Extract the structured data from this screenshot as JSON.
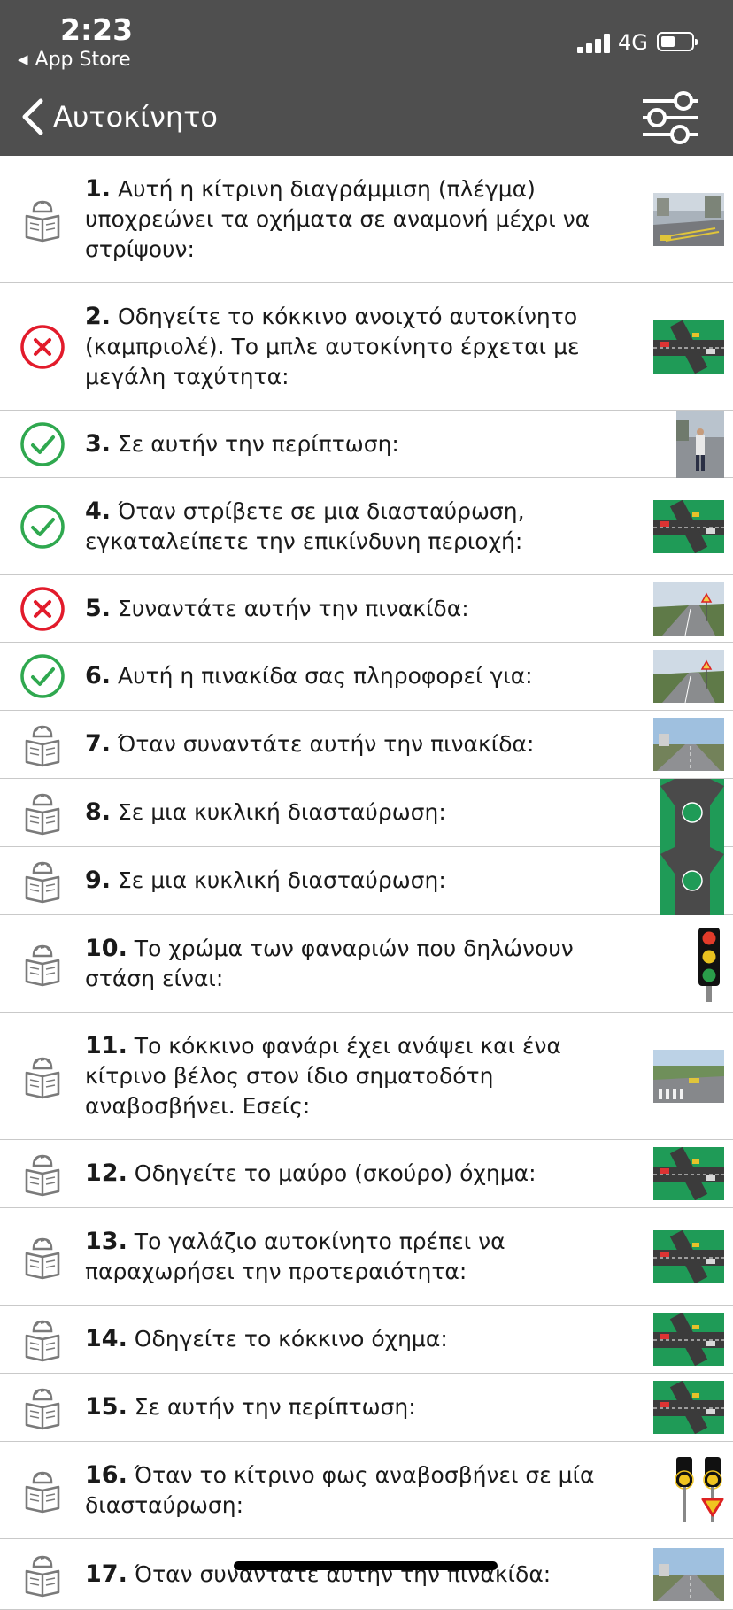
{
  "status_bar": {
    "time": "2:23",
    "back_app": "App Store",
    "network": "4G",
    "battery_level": 0.45
  },
  "nav": {
    "title": "Αυτοκίνητο",
    "background": "#4f4f4f"
  },
  "colors": {
    "correct": "#2fa84f",
    "wrong": "#e21b2b",
    "unanswered_icon": "#7a7a7a"
  },
  "questions": [
    {
      "num": "1.",
      "text": "Αυτή η κίτρινη διαγράμμιση (πλέγμα) υποχρεώνει τα οχήματα σε αναμονή μέχρι να στρίψουν:",
      "status": "unanswered",
      "status_icon": "reading-person-icon",
      "image": "city-street-photo"
    },
    {
      "num": "2.",
      "text": "Οδηγείτε το κόκκινο ανοιχτό αυτοκίνητο (καμπριολέ). Το μπλε αυτοκίνητο έρχεται με μεγάλη ταχύτητα:",
      "status": "wrong",
      "status_icon": "wrong-x-icon",
      "image": "intersection-diagram"
    },
    {
      "num": "3.",
      "text": "Σε αυτήν την περίπτωση:",
      "status": "correct",
      "status_icon": "correct-check-icon",
      "image": "traffic-officer-photo"
    },
    {
      "num": "4.",
      "text": "Όταν στρίβετε σε μια διασταύρωση, εγκαταλείπετε την επικίνδυνη περιοχή:",
      "status": "correct",
      "status_icon": "correct-check-icon",
      "image": "intersection-diagram"
    },
    {
      "num": "5.",
      "text": "Συναντάτε αυτήν την πινακίδα:",
      "status": "wrong",
      "status_icon": "wrong-x-icon",
      "image": "road-sign-photo"
    },
    {
      "num": "6.",
      "text": "Αυτή η πινακίδα σας πληροφορεί για:",
      "status": "correct",
      "status_icon": "correct-check-icon",
      "image": "road-sign-photo"
    },
    {
      "num": "7.",
      "text": "Όταν συναντάτε αυτήν την πινακίδα:",
      "status": "unanswered",
      "status_icon": "reading-person-icon",
      "image": "road-photo"
    },
    {
      "num": "8.",
      "text": "Σε μια κυκλική διασταύρωση:",
      "status": "unanswered",
      "status_icon": "reading-person-icon",
      "image": "roundabout-diagram"
    },
    {
      "num": "9.",
      "text": "Σε μια κυκλική διασταύρωση:",
      "status": "unanswered",
      "status_icon": "reading-person-icon",
      "image": "roundabout-diagram"
    },
    {
      "num": "10.",
      "text": "Το χρώμα των φαναριών που δηλώνουν στάση είναι:",
      "status": "unanswered",
      "status_icon": "reading-person-icon",
      "image": "traffic-light-icon"
    },
    {
      "num": "11.",
      "text": "Το κόκκινο φανάρι έχει ανάψει και ένα κίτρινο βέλος στον ίδιο σηματοδότη αναβοσβήνει. Εσείς:",
      "status": "unanswered",
      "status_icon": "reading-person-icon",
      "image": "crosswalk-photo"
    },
    {
      "num": "12.",
      "text": "Οδηγείτε το μαύρο (σκούρο) όχημα:",
      "status": "unanswered",
      "status_icon": "reading-person-icon",
      "image": "intersection-diagram"
    },
    {
      "num": "13.",
      "text": "Το γαλάζιο αυτοκίνητο πρέπει να παραχωρήσει την προτεραιότητα:",
      "status": "unanswered",
      "status_icon": "reading-person-icon",
      "image": "intersection-diagram"
    },
    {
      "num": "14.",
      "text": "Οδηγείτε το κόκκινο όχημα:",
      "status": "unanswered",
      "status_icon": "reading-person-icon",
      "image": "intersection-diagram"
    },
    {
      "num": "15.",
      "text": "Σε αυτήν την περίπτωση:",
      "status": "unanswered",
      "status_icon": "reading-person-icon",
      "image": "intersection-diagram"
    },
    {
      "num": "16.",
      "text": "Όταν το κίτρινο φως αναβοσβήνει σε μία διασταύρωση:",
      "status": "unanswered",
      "status_icon": "reading-person-icon",
      "image": "flashing-lights-icon"
    },
    {
      "num": "17.",
      "text": "Όταν συναντάτε αυτήν την πινακίδα:",
      "status": "unanswered",
      "status_icon": "reading-person-icon",
      "image": "road-photo"
    }
  ]
}
